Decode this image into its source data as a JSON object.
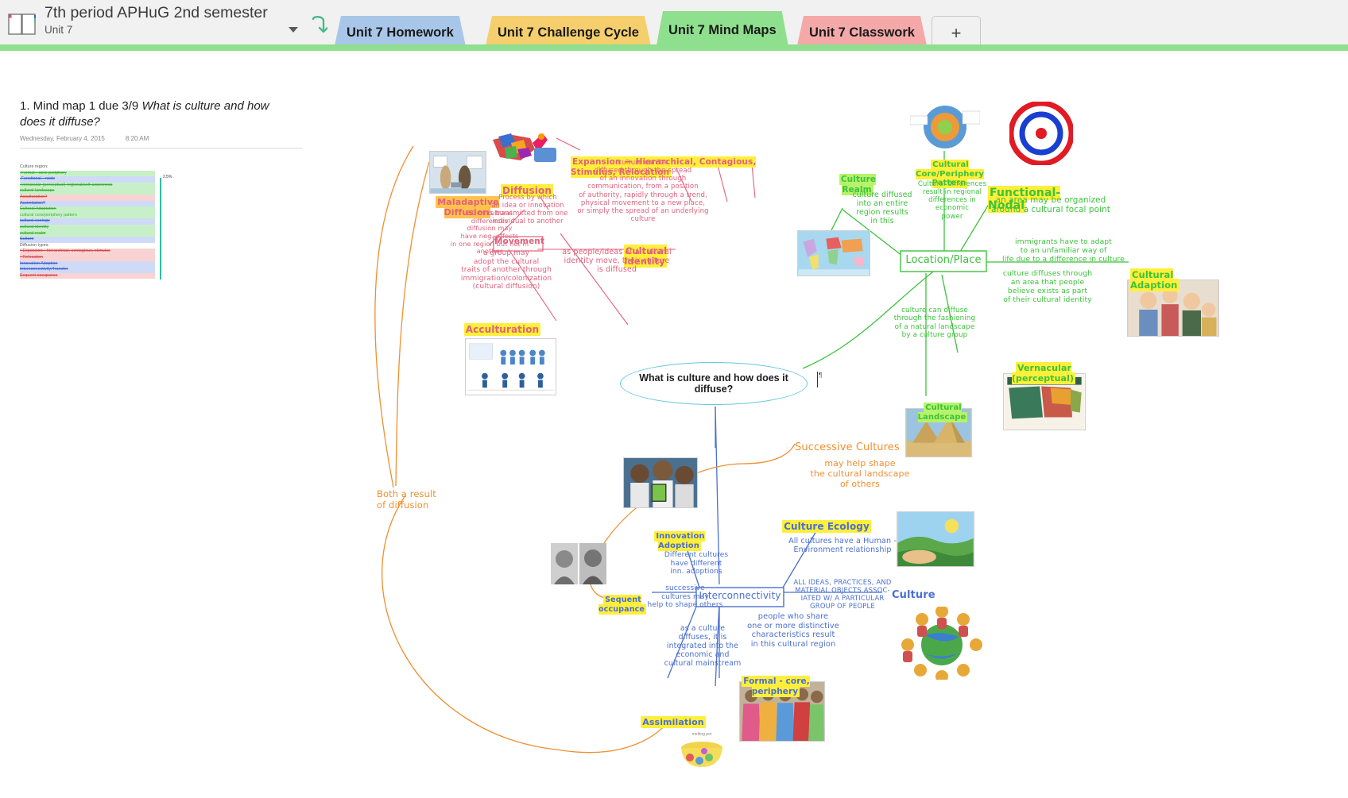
{
  "window": {
    "notebook_title": "7th period APHuG 2nd semester",
    "section_subtitle": "Unit 7",
    "dropdown_icon": "chevron-down-icon",
    "sync_icon": "sync-icon",
    "notebook_icon": "notebook-icon"
  },
  "tabs": {
    "items": [
      {
        "label": "Unit 7 Homework",
        "color": "#a8c6e8",
        "active": false
      },
      {
        "label": "Unit 7 Challenge Cycle",
        "color": "#f5cf6d",
        "active": false
      },
      {
        "label": "Unit 7 Mind Maps",
        "color": "#8ee08e",
        "active": true
      },
      {
        "label": "Unit 7 Classwork",
        "color": "#f5a8a8",
        "active": false
      }
    ],
    "add_label": "+"
  },
  "document": {
    "title_prefix": "1.  Mind map 1 due 3/9 ",
    "title_italic": "What is culture and how does it diffuse?",
    "date": "Wednesday, February 4, 2015",
    "time": "8:20 AM",
    "list": [
      {
        "text": "Culture region:",
        "style": "p"
      },
      {
        "text": "-Formal—core-periphery",
        "style": "g st"
      },
      {
        "text": "-Functional—node",
        "style": "b st"
      },
      {
        "text": "-vernacular (perceptual)-regional/self-awareness",
        "style": "g st"
      },
      {
        "text": "cultural landscape",
        "style": "g st"
      },
      {
        "text": "Acculturation?",
        "style": "r st"
      },
      {
        "text": "Assimilation?",
        "style": "b st"
      },
      {
        "text": "Cultural Adaptation",
        "style": "g st"
      },
      {
        "text": "cultural core/periphery pattern",
        "style": "g"
      },
      {
        "text": "cultural ecology",
        "style": "b st"
      },
      {
        "text": "cultural identity",
        "style": "g st"
      },
      {
        "text": "cultural realm",
        "style": "g st"
      },
      {
        "text": "Culture",
        "style": "b st"
      },
      {
        "text": "Diffusion types:",
        "style": "p"
      },
      {
        "text": "• Expansion—hierarchical, contagious, stimulus",
        "style": "r st"
      },
      {
        "text": "• Relocation",
        "style": "r st"
      },
      {
        "text": "Innovation Adoption",
        "style": "b st"
      },
      {
        "text": "Interconnectivity/Transfer",
        "style": "b st"
      },
      {
        "text": "Sequent occupance",
        "style": "r st"
      }
    ],
    "bar_label": "2.5%"
  },
  "mindmap": {
    "center": "What is culture and how does it diffuse?",
    "branch_pink": {
      "label_maladaptive": "Maladaptive\nDiffusion",
      "label_diffusion": "Diffusion",
      "label_movement": "Movement",
      "label_acculturation": "Acculturation",
      "label_cultural_identity": "Cultural Identity",
      "label_expansion": "Expansion — Hierarchical, Contagious, Stimulus, Relocation",
      "text_diffusion_def": "Process by which\nan idea or innovation\nis transmitted from one\nindividual to another",
      "text_maladaptive": "BC of cultural\ndifferences\ndiffusion may\nhave neg. effects\nin one region but not in\nanother",
      "text_acculturation": "a group may\nadopt the cultural\ntraits of another through\nimmigration/colonization\n(cultural diffusion)",
      "text_expansion_def": "culture can be\ndiffused through the spread\nof an innovation through\ncommunication, from a position\nof authority, rapidly through a trend,\nphysical movement to a new place,\nor simply the spread of an underlying\nculture",
      "text_cultural_identity": "as people/ideas of a cultural\nidentity move, their culture\nis diffused"
    },
    "branch_green": {
      "label_culture_realm": "Culture Realm",
      "label_core_periphery": "Cultural Core/Periphery\nPattern",
      "label_functional_nodal": "Functional- Nodal",
      "label_location_place": "Location/Place",
      "label_cultural_adaption": "Cultural Adaption",
      "label_vernacular": "Vernacular (perceptual)",
      "label_cultural_landscape": "Cultural Landscape",
      "text_culture_realm": "culture diffused\ninto an entire\nregion results\nin this",
      "text_core_periphery": "Cultural differences\nresult in regional\ndifferences in economic\npower",
      "text_functional_nodal": "an area may be organized\naround a cultural focal point",
      "text_cultural_adaption": "immigrants have to adapt\nto an unfamiliar way of\nlife due to a difference in culture",
      "text_vernacular": "culture diffuses through\nan area that people\nbelieve exists as part\nof their cultural identity",
      "text_cultural_landscape": "culture can diffuse\nthrough the fashioning\nof a natural landscape\nby a culture group"
    },
    "branch_blue": {
      "label_innovation_adoption": "Innovation\nAdoption",
      "label_sequent_occupance": "Sequent\noccupance",
      "label_interconnectivity": "Interconnectivity",
      "label_culture_ecology": "Culture Ecology",
      "label_culture": "Culture",
      "label_formal_core_periphery": "Formal - core, periphery",
      "label_assimilation": "Assimilation",
      "text_innovation": "Different cultures\nhave different\ninn. adoptions",
      "text_sequent": "successive\ncultures may\nhelp to shape others",
      "text_integration": "as a culture\ndiffuses, it is\nintegrated into the\neconomic and\ncultural mainstream",
      "text_culture_ecology": "All cultures have a Human -\nEnvironment relationship",
      "text_culture_def": "ALL IDEAS, PRACTICES, AND\nMATERIAL OBJECTS ASSOC-\nIATED W/ A PARTICULAR\nGROUP OF PEOPLE",
      "text_formal": "people who share\none or more distinctive\ncharacteristics result\nin this cultural region"
    },
    "branch_orange": {
      "text_both_result": "Both a result\nof diffusion",
      "label_successive_cultures": "Successive Cultures",
      "text_successive": "may help shape\nthe cultural landscape\nof others"
    }
  }
}
